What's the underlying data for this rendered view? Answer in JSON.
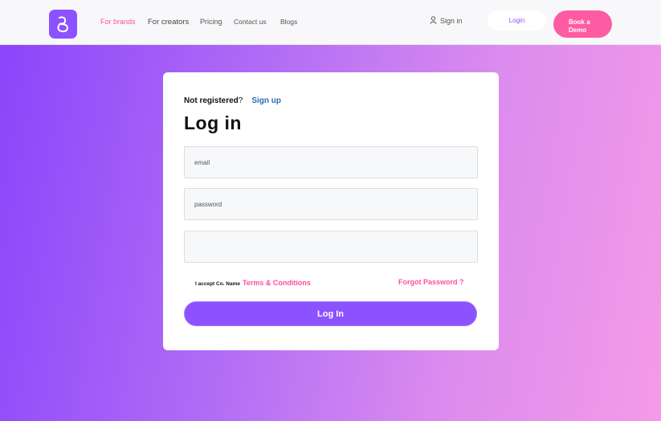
{
  "nav": {
    "links": [
      "For brands",
      "For creators",
      "Pricing",
      "Contact us",
      "Blogs"
    ],
    "signin_label": "Sign in",
    "login_label": "Login",
    "demo_line1": "Book a",
    "demo_line2": "Demo"
  },
  "form": {
    "not_registered": "Not registered",
    "question_mark": "?",
    "signup_label": "Sign up",
    "title": "Log in",
    "email_placeholder": "email",
    "password_placeholder": "password",
    "extra_placeholder": "",
    "accept_text": "I accept Co. Name",
    "terms_link": "Terms & Conditions",
    "forgot_label": "Forgot Password ?",
    "submit_label": "Log In"
  },
  "colors": {
    "accent": "#8c52ff",
    "pink": "#ff4d9d",
    "demo_button": "#ff5ba3",
    "link_blue": "#2b6cb0"
  },
  "icons": [
    "brand-logo-icon",
    "user-icon"
  ]
}
